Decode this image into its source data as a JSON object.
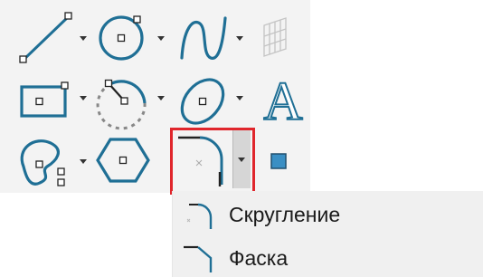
{
  "toolbar": {
    "tools": [
      {
        "name": "line-tool",
        "icon": "line-icon",
        "has_dropdown": true
      },
      {
        "name": "circle-tool",
        "icon": "circle-icon",
        "has_dropdown": true
      },
      {
        "name": "spline-tool",
        "icon": "spline-icon",
        "has_dropdown": true
      },
      {
        "name": "hatch-tool",
        "icon": "hatch-icon",
        "has_dropdown": false,
        "disabled": true
      },
      {
        "name": "rectangle-tool",
        "icon": "rectangle-icon",
        "has_dropdown": true
      },
      {
        "name": "arc-tool",
        "icon": "arc-icon",
        "has_dropdown": true
      },
      {
        "name": "ellipse-tool",
        "icon": "ellipse-icon",
        "has_dropdown": true
      },
      {
        "name": "text-tool",
        "icon": "text-icon",
        "label": "A",
        "has_dropdown": false
      },
      {
        "name": "contour-tool",
        "icon": "contour-icon",
        "has_dropdown": true
      },
      {
        "name": "polygon-tool",
        "icon": "polygon-icon",
        "has_dropdown": false
      },
      {
        "name": "fillet-tool",
        "icon": "fillet-icon",
        "has_dropdown": true,
        "highlighted": true
      },
      {
        "name": "point-tool",
        "icon": "point-icon",
        "has_dropdown": false
      }
    ]
  },
  "menu": {
    "items": [
      {
        "label": "Скругление",
        "icon": "fillet-icon"
      },
      {
        "label": "Фаска",
        "icon": "chamfer-icon"
      }
    ]
  },
  "colors": {
    "accent": "#1f6f95",
    "highlight": "#e0262c",
    "panel_bg": "#f3f3f3",
    "menu_bg": "#f0f0f0"
  }
}
